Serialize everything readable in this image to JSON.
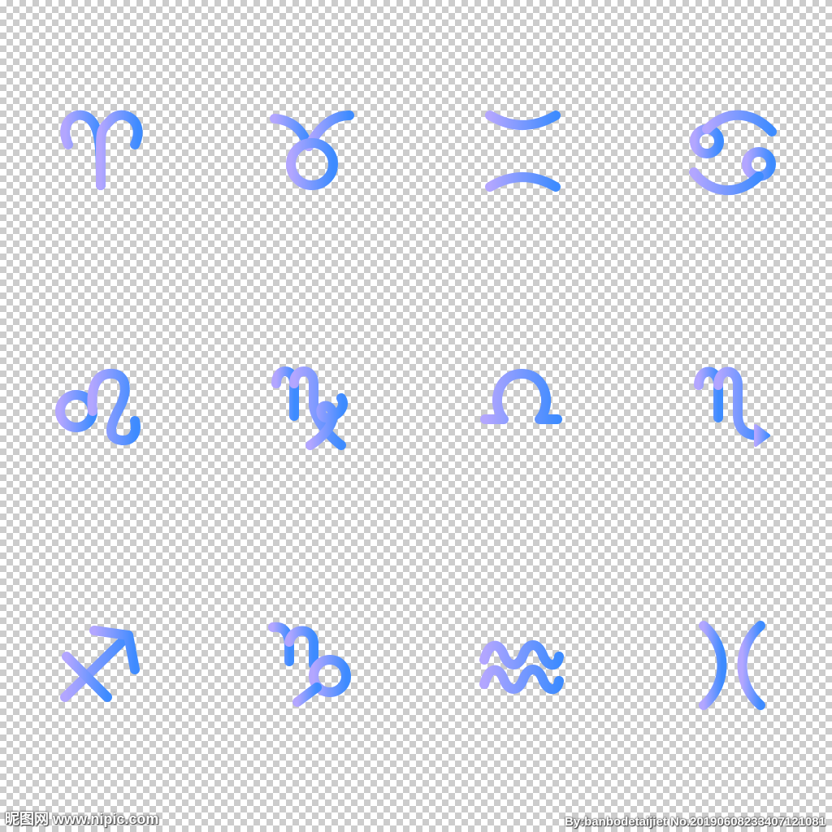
{
  "colors": {
    "gradient_start": "#b3a6ff",
    "gradient_end": "#3d8bff"
  },
  "icons": [
    {
      "name": "aries-icon"
    },
    {
      "name": "taurus-icon"
    },
    {
      "name": "gemini-icon"
    },
    {
      "name": "cancer-icon"
    },
    {
      "name": "leo-icon"
    },
    {
      "name": "virgo-icon"
    },
    {
      "name": "libra-icon"
    },
    {
      "name": "scorpio-icon"
    },
    {
      "name": "sagittarius-icon"
    },
    {
      "name": "capricorn-icon"
    },
    {
      "name": "aquarius-icon"
    },
    {
      "name": "pisces-icon"
    }
  ],
  "watermark": {
    "left_text": "昵图网 www.nipic.com",
    "right_text": "By:banbodetaijiet No.20190608233407121081"
  }
}
